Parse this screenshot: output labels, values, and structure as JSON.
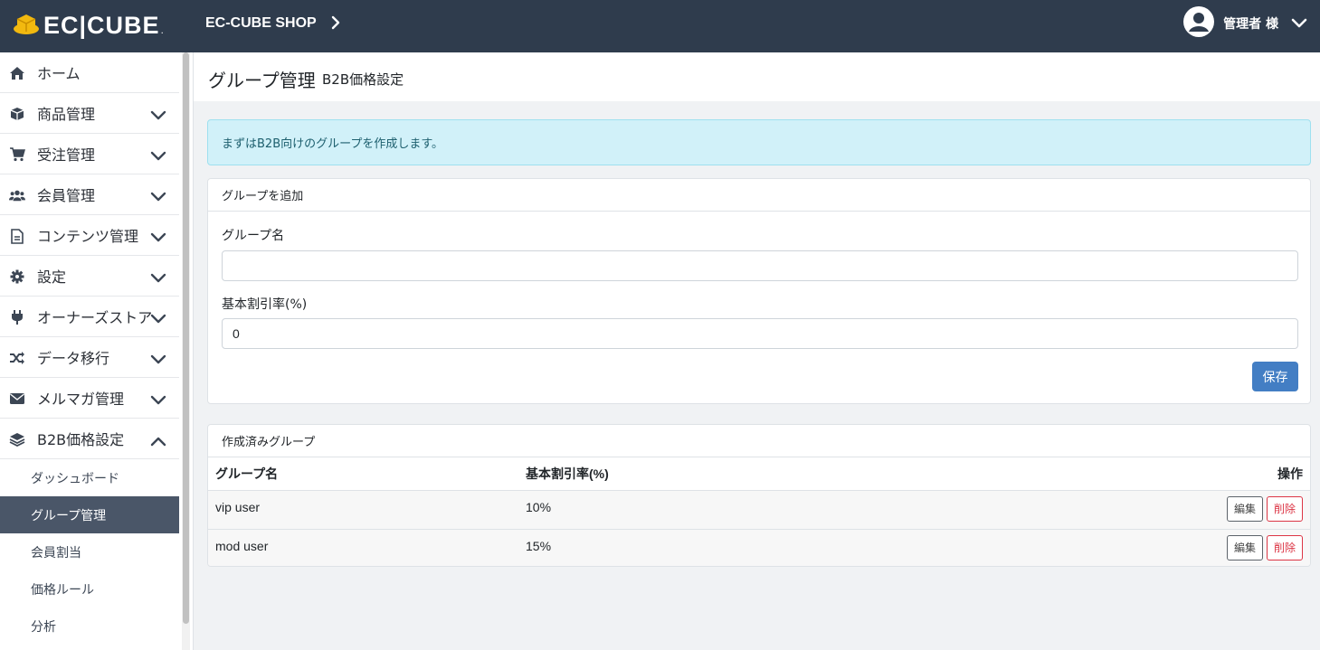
{
  "header": {
    "logo_text": "EC|CUBE",
    "logo_mark": ".",
    "shop_name": "EC-CUBE SHOP",
    "user_name": "管理者 様"
  },
  "sidebar": {
    "items": [
      {
        "label": "ホーム",
        "icon": "home-icon"
      },
      {
        "label": "商品管理",
        "icon": "box-icon"
      },
      {
        "label": "受注管理",
        "icon": "cart-icon"
      },
      {
        "label": "会員管理",
        "icon": "users-icon"
      },
      {
        "label": "コンテンツ管理",
        "icon": "file-icon"
      },
      {
        "label": "設定",
        "icon": "gear-icon"
      },
      {
        "label": "オーナーズストア",
        "icon": "plug-icon"
      },
      {
        "label": "データ移行",
        "icon": "shuffle-icon"
      },
      {
        "label": "メルマガ管理",
        "icon": "envelope-icon"
      },
      {
        "label": "B2B価格設定",
        "icon": "layers-icon"
      }
    ],
    "subitems": [
      {
        "label": "ダッシュボード"
      },
      {
        "label": "グループ管理"
      },
      {
        "label": "会員割当"
      },
      {
        "label": "価格ルール"
      },
      {
        "label": "分析"
      }
    ],
    "active_subitem": "グループ管理"
  },
  "page": {
    "title": "グループ管理",
    "subtitle": "B2B価格設定"
  },
  "alert": {
    "text": "まずはB2B向けのグループを作成します。"
  },
  "add_group": {
    "header": "グループを追加",
    "name_label": "グループ名",
    "name_value": "",
    "discount_label": "基本割引率(%)",
    "discount_value": "0",
    "save_label": "保存"
  },
  "groups": {
    "header": "作成済みグループ",
    "columns": [
      "グループ名",
      "基本割引率(%)",
      "操作"
    ],
    "rows": [
      {
        "name": "vip user",
        "discount": "10%",
        "edit": "編集",
        "delete": "削除"
      },
      {
        "name": "mod user",
        "discount": "15%",
        "edit": "編集",
        "delete": "削除"
      }
    ]
  },
  "colors": {
    "header_bg": "#2f3c4d",
    "primary": "#437ec4",
    "danger": "#dc3545",
    "alert_bg": "#d1f1f9",
    "active_nav": "#4a5668"
  }
}
